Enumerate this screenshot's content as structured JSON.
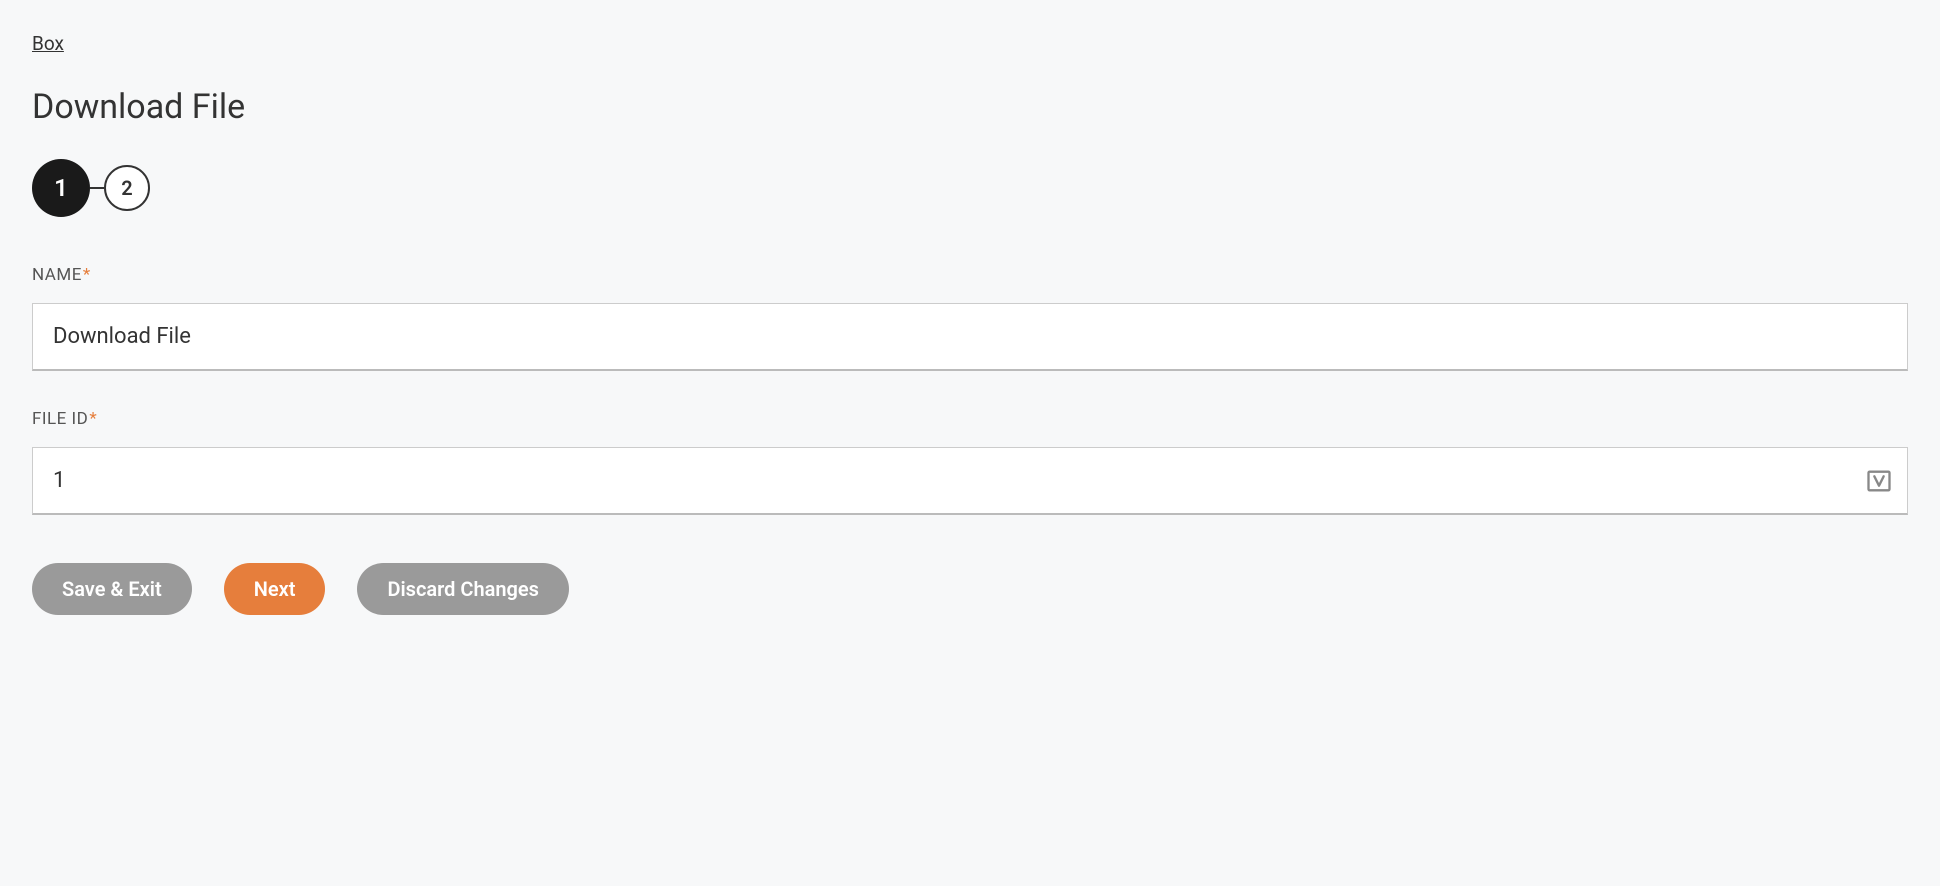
{
  "breadcrumb": {
    "label": "Box"
  },
  "page": {
    "title": "Download File"
  },
  "stepper": {
    "steps": [
      "1",
      "2"
    ],
    "activeIndex": 0
  },
  "form": {
    "name": {
      "label": "NAME",
      "required": true,
      "value": "Download File"
    },
    "fileId": {
      "label": "FILE ID",
      "required": true,
      "value": "1"
    }
  },
  "buttons": {
    "saveExit": "Save & Exit",
    "next": "Next",
    "discard": "Discard Changes"
  },
  "asterisk": "*"
}
